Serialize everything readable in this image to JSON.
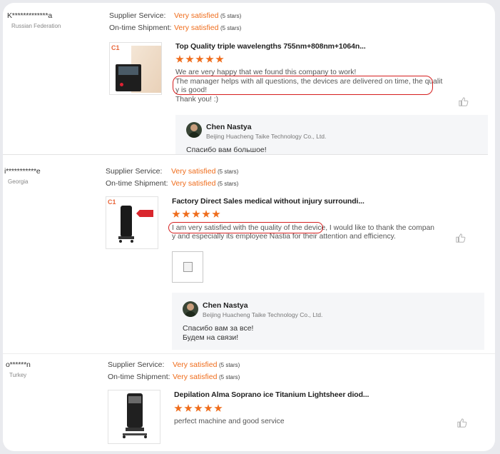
{
  "reviews": [
    {
      "user": "K*************a",
      "country": "Russian Federation",
      "supplier_label": "Supplier Service:",
      "supplier_value": "Very satisfied",
      "supplier_stars": "(5 stars)",
      "shipment_label": "On-time Shipment:",
      "shipment_value": "Very satisfied",
      "shipment_stars": "(5 stars)",
      "product_badge": "C1",
      "product_title": "Top Quality triple wavelengths 755nm+808nm+1064n...",
      "rating": 5,
      "text_lines": [
        "We are very happy that we found this company to work!",
        "The manager helps with all questions, the devices are delivered on time, the qualit",
        "y is good!",
        "Thank you! :)"
      ],
      "reply_name": "Chen Nastya",
      "reply_company": "Beijing Huacheng Taike Technology Co., Ltd.",
      "reply_lines": [
        "Спасибо вам большое!"
      ]
    },
    {
      "user": "i***********e",
      "country": "Georgia",
      "supplier_label": "Supplier Service:",
      "supplier_value": "Very satisfied",
      "supplier_stars": "(5 stars)",
      "shipment_label": "On-time Shipment:",
      "shipment_value": "Very satisfied",
      "shipment_stars": "(5 stars)",
      "product_badge": "C1",
      "product_title": "Factory Direct Sales medical without injury surroundi...",
      "rating": 5,
      "text_lines": [
        "I am very satisfied with the quality of the device, I would like to thank the compan",
        "y and especially its employee Nastia for their attention and efficiency."
      ],
      "reply_name": "Chen Nastya",
      "reply_company": "Beijing Huacheng Taike Technology Co., Ltd.",
      "reply_lines": [
        "Спасибо вам за все!",
        "Будем на связи!"
      ]
    },
    {
      "user": "o******n",
      "country": "Turkey",
      "supplier_label": "Supplier Service:",
      "supplier_value": "Very satisfied",
      "supplier_stars": "(5 stars)",
      "shipment_label": "On-time Shipment:",
      "shipment_value": "Very satisfied",
      "shipment_stars": "(5 stars)",
      "product_title": "Depilation Alma Soprano ice Titanium Lightsheer diod...",
      "rating": 5,
      "text_lines": [
        "perfect machine and good service"
      ]
    }
  ],
  "colors": {
    "accent": "#ef6c1b",
    "highlight_circle": "#d51e1e"
  },
  "icons": {
    "like": "thumbs-up-icon",
    "broken_image": "broken-image-icon"
  }
}
